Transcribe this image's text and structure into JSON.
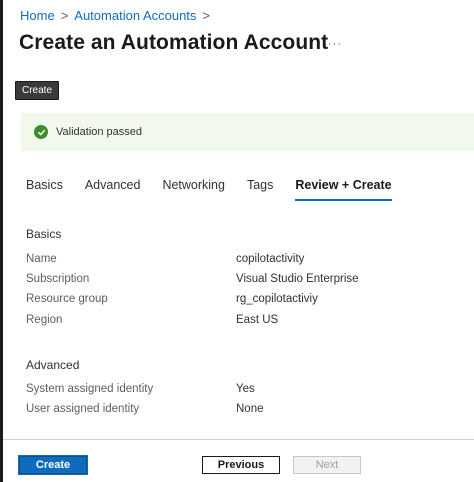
{
  "breadcrumb": {
    "home": "Home",
    "automation_accounts": "Automation Accounts",
    "separator": ">"
  },
  "header": {
    "title": "Create an Automation Account",
    "more_label": "···"
  },
  "tooltip": {
    "text": "Create"
  },
  "validation": {
    "status": "Validation passed",
    "color": "#3d8b2e"
  },
  "tabs": [
    {
      "label": "Basics"
    },
    {
      "label": "Advanced"
    },
    {
      "label": "Networking"
    },
    {
      "label": "Tags"
    },
    {
      "label": "Review + Create",
      "active": true
    }
  ],
  "basics": {
    "title": "Basics",
    "rows": [
      {
        "label": "Name",
        "value": "copilotactivity"
      },
      {
        "label": "Subscription",
        "value": "Visual Studio Enterprise"
      },
      {
        "label": "Resource group",
        "value": "rg_copilotactiviy"
      },
      {
        "label": "Region",
        "value": "East US"
      }
    ]
  },
  "advanced": {
    "title": "Advanced",
    "rows": [
      {
        "label": "System assigned identity",
        "value": "Yes"
      },
      {
        "label": "User assigned identity",
        "value": "None"
      }
    ]
  },
  "footer": {
    "create_label": "Create",
    "previous_label": "Previous",
    "next_label": "Next"
  },
  "colors": {
    "accent": "#0f6cbd",
    "success_bg": "#f1f9ec"
  }
}
